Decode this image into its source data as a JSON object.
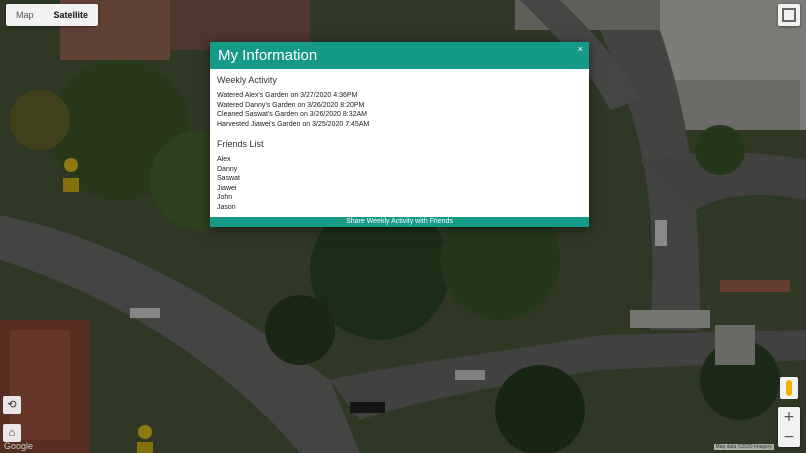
{
  "map": {
    "type_buttons": [
      "Map",
      "Satellite"
    ],
    "active_type": "Satellite",
    "google_label": "Google",
    "zoom_in": "+",
    "zoom_out": "−",
    "attribution": "Map data ©2020 Imagery"
  },
  "modal": {
    "title": "My Information",
    "close": "×",
    "weekly_activity": {
      "heading": "Weekly Activity",
      "items": [
        "Watered Alex's Garden on 3/27/2020 4:36PM",
        "Watered Danny's Garden on 3/26/2020 8:20PM",
        "Cleaned Saswat's Garden on 3/26/2020 8:32AM",
        "Harvested Jiawei's Garden on 3/25/2020 7:45AM"
      ]
    },
    "friends": {
      "heading": "Friends List",
      "items": [
        "Alex",
        "Danny",
        "Saswat",
        "Jiawei",
        "John",
        "Jason"
      ]
    },
    "share_button": "Share Weekly Activity with Friends"
  },
  "colors": {
    "accent": "#159a88"
  }
}
